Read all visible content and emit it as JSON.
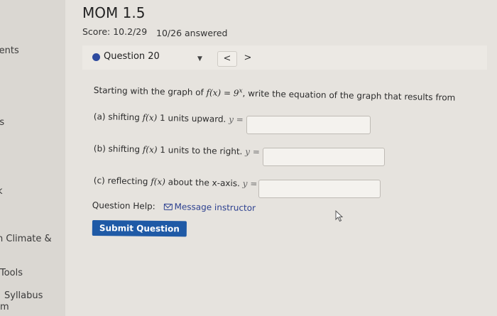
{
  "sidebar": {
    "items": [
      {
        "label": "ments"
      },
      {
        "label": "nts"
      },
      {
        "label": "k"
      },
      {
        "label": "n Climate &"
      },
      {
        "label": "Tools"
      },
      {
        "label": "Syllabus"
      },
      {
        "label": "m"
      }
    ]
  },
  "assignment": {
    "title": "MOM 1.5",
    "score": "Score: 10.2/29",
    "answered": "10/26 answered"
  },
  "question": {
    "label": "Question 20",
    "prev_label": "<",
    "next_label": ">",
    "prompt_pre": "Starting with the graph of ",
    "prompt_math": "f(x) = 9",
    "prompt_sup": "x",
    "prompt_post": ", write the equation of the graph that results from",
    "parts": [
      {
        "prefix": "(a) shifting ",
        "fn": "f(x)",
        "suffix": " 1 units upward.",
        "eq": "y ="
      },
      {
        "prefix": "(b) shifting ",
        "fn": "f(x)",
        "suffix": " 1 units to the right.",
        "eq": "y ="
      },
      {
        "prefix": "(c) reflecting ",
        "fn": "f(x)",
        "suffix": " about the x-axis.",
        "eq": "y ="
      }
    ],
    "help_label": "Question Help:",
    "message_label": "Message instructor",
    "submit_label": "Submit Question"
  },
  "colors": {
    "accent": "#1f5aa6",
    "dot": "#2d4a9e",
    "link": "#2b3f8f"
  }
}
